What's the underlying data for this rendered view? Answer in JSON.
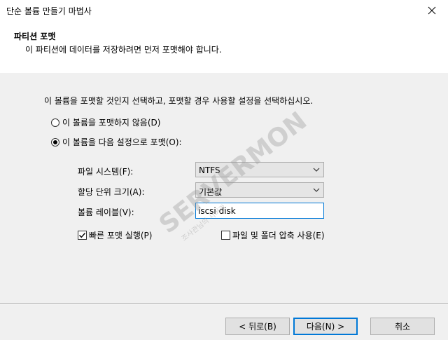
{
  "window": {
    "title": "단순 볼륨 만들기 마법사",
    "close_icon": "close-icon"
  },
  "header": {
    "title": "파티션 포맷",
    "subtitle": "이 파티션에 데이터를 저장하려면 먼저 포맷해야 합니다."
  },
  "body": {
    "instruction": "이 볼륨을 포맷할 것인지 선택하고, 포맷할 경우 사용할 설정을 선택하십시오.",
    "radio_no_format": {
      "label": "이 볼륨을 포맷하지 않음(D)",
      "selected": false
    },
    "radio_format": {
      "label": "이 볼륨을 다음 설정으로 포맷(O):",
      "selected": true
    },
    "file_system": {
      "label": "파일 시스템(F):",
      "value": "NTFS"
    },
    "allocation_unit": {
      "label": "할당 단위 크기(A):",
      "value": "기본값"
    },
    "volume_label": {
      "label": "볼륨 레이블(V):",
      "value": "iscsi disk"
    },
    "quick_format": {
      "label": "빠른 포맷 실행(P)",
      "checked": true
    },
    "compression": {
      "label": "파일 및 폴더 압축 사용(E)",
      "checked": false
    }
  },
  "watermark": {
    "brand": "SERVERMON",
    "tagline": "조사관님의 서버관"
  },
  "footer": {
    "back_label": "< 뒤로(B)",
    "next_label": "다음(N) >",
    "cancel_label": "취소"
  },
  "colors": {
    "accent": "#0078d7",
    "watermark_green": "#8cc63f",
    "watermark_gray": "#9a9a9a"
  }
}
